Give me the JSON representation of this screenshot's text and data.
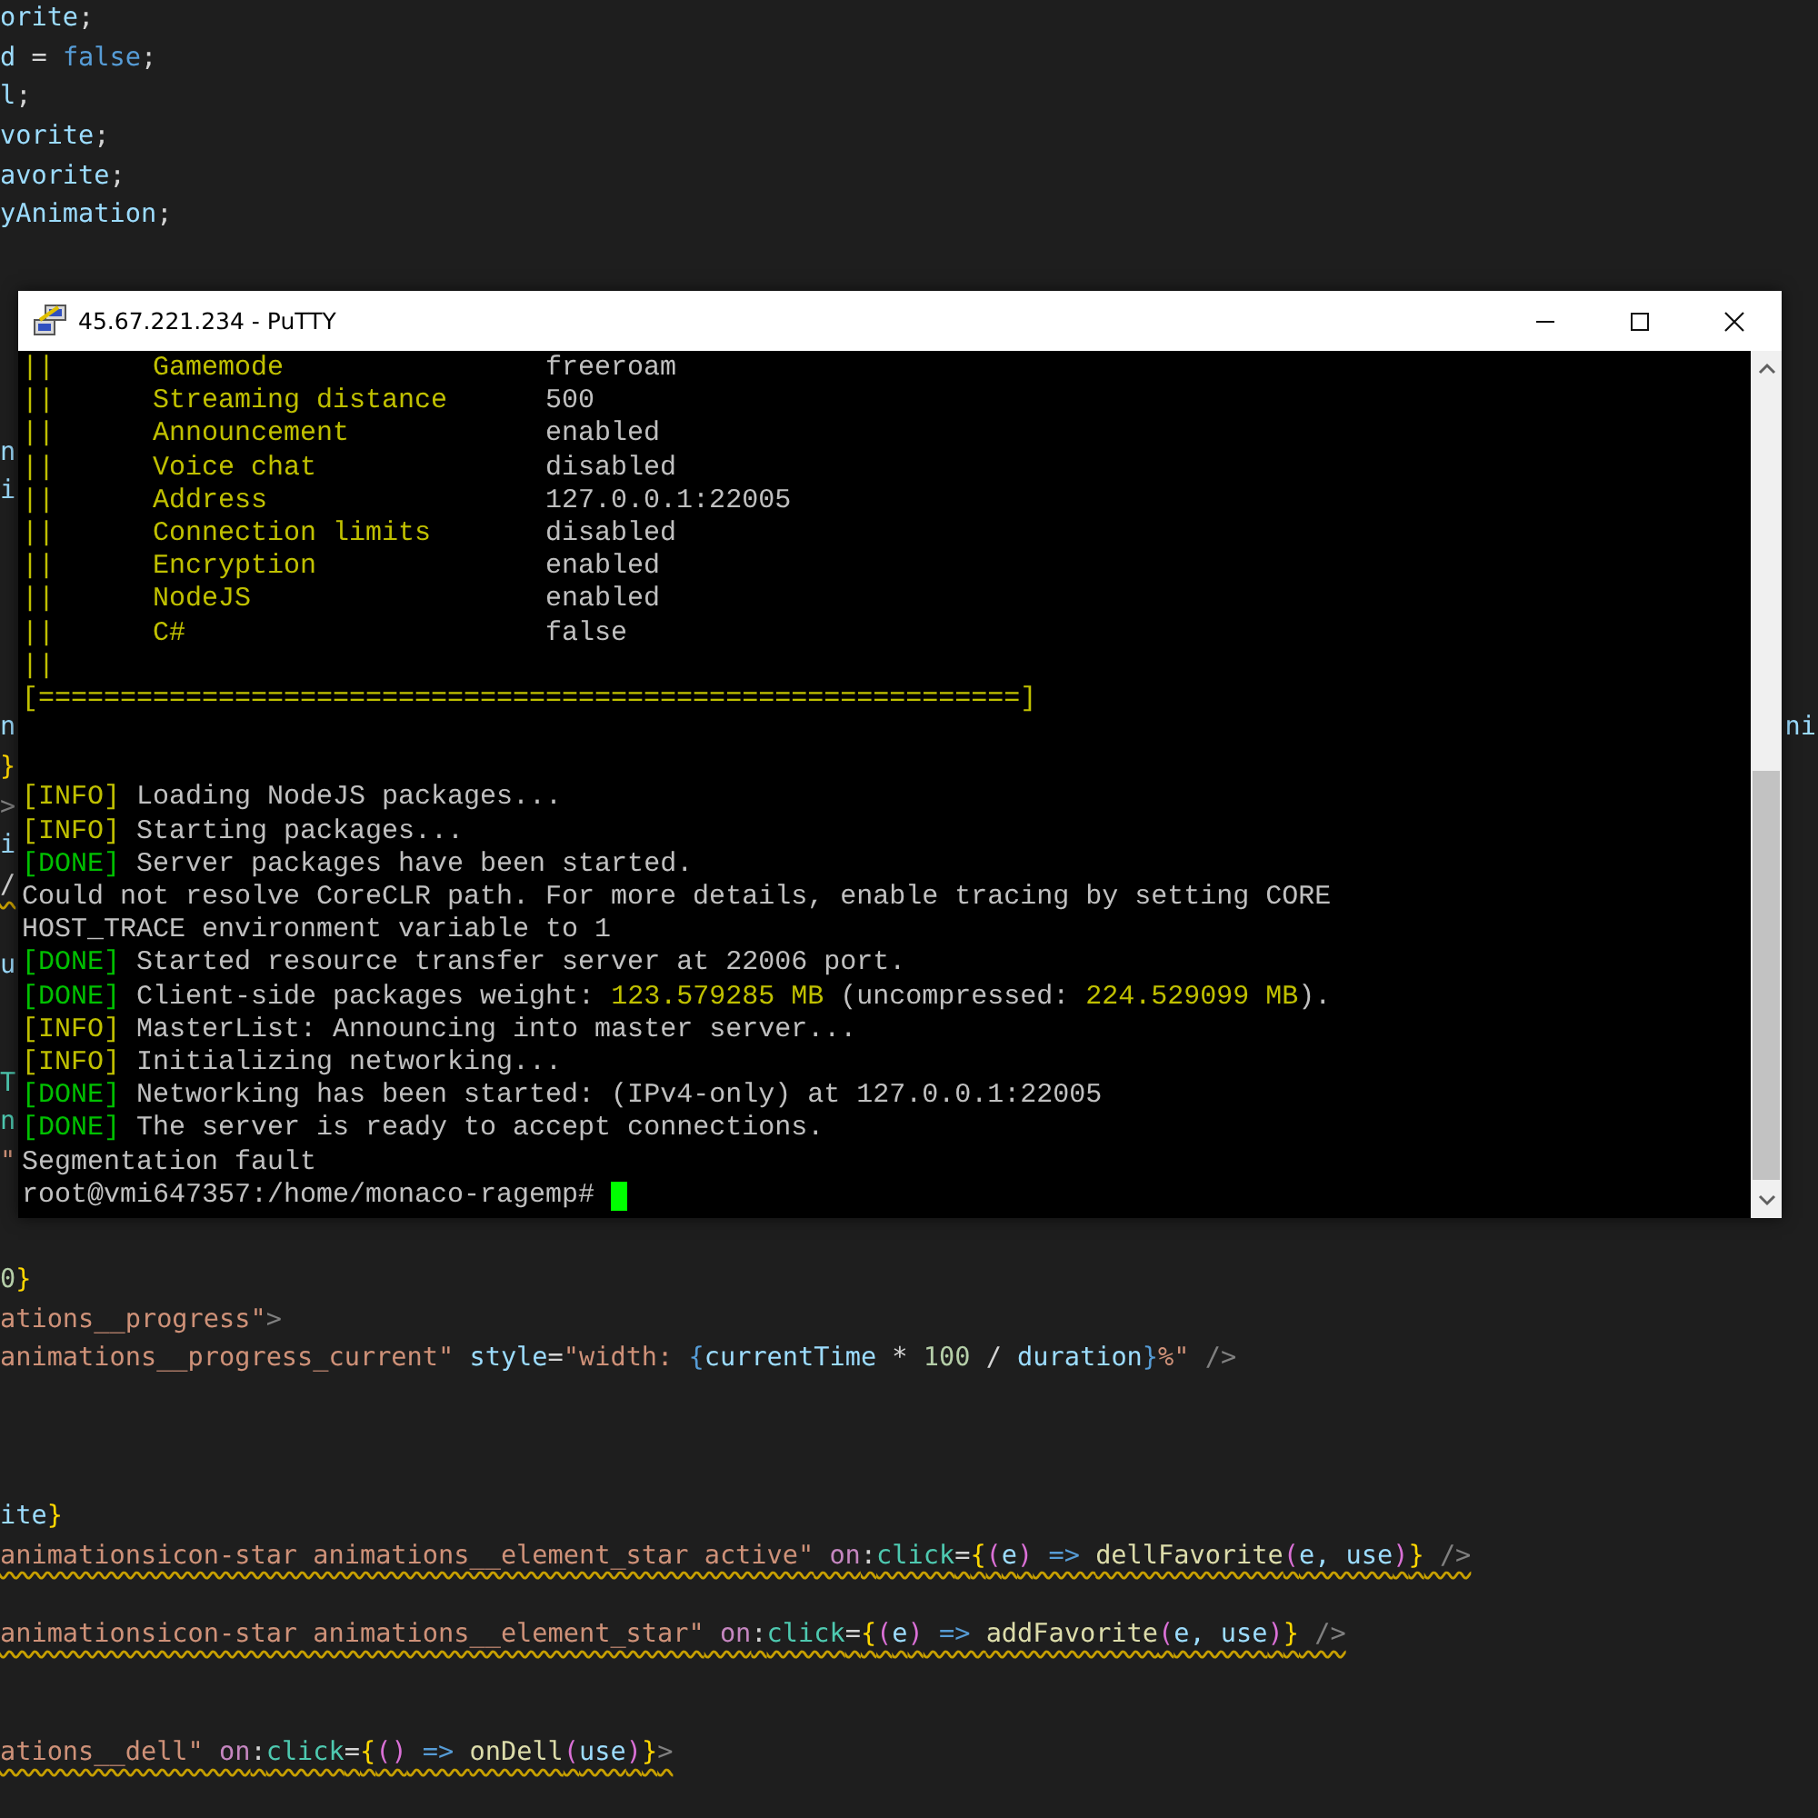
{
  "editor": {
    "lines": [
      {
        "kind": "code",
        "warning": false,
        "tokens": [
          {
            "text": "orite",
            "color": "#9cdcfe"
          },
          {
            "text": ";",
            "color": "#d4d4d4"
          }
        ]
      },
      {
        "kind": "code",
        "warning": false,
        "tokens": [
          {
            "text": "d",
            "color": "#9cdcfe"
          },
          {
            "text": " = ",
            "color": "#d4d4d4"
          },
          {
            "text": "false",
            "color": "#569cd6"
          },
          {
            "text": ";",
            "color": "#d4d4d4"
          }
        ]
      },
      {
        "kind": "code",
        "warning": false,
        "tokens": [
          {
            "text": "l",
            "color": "#9cdcfe"
          },
          {
            "text": ";",
            "color": "#d4d4d4"
          }
        ]
      },
      {
        "kind": "code",
        "warning": false,
        "tokens": [
          {
            "text": "vorite",
            "color": "#9cdcfe"
          },
          {
            "text": ";",
            "color": "#d4d4d4"
          }
        ]
      },
      {
        "kind": "code",
        "warning": false,
        "tokens": [
          {
            "text": "avorite",
            "color": "#9cdcfe"
          },
          {
            "text": ";",
            "color": "#d4d4d4"
          }
        ]
      },
      {
        "kind": "code",
        "warning": false,
        "tokens": [
          {
            "text": "yAnimation",
            "color": "#9cdcfe"
          },
          {
            "text": ";",
            "color": "#d4d4d4"
          }
        ]
      },
      {
        "kind": "blank"
      },
      {
        "kind": "blank"
      },
      {
        "kind": "blank"
      },
      {
        "kind": "blank"
      },
      {
        "kind": "blank"
      },
      {
        "kind": "code",
        "warning": false,
        "tokens": [
          {
            "text": "n",
            "color": "#9cdcfe"
          }
        ]
      },
      {
        "kind": "code",
        "warning": false,
        "tokens": [
          {
            "text": "i",
            "color": "#9cdcfe"
          }
        ]
      },
      {
        "kind": "blank"
      },
      {
        "kind": "blank"
      },
      {
        "kind": "blank"
      },
      {
        "kind": "blank"
      },
      {
        "kind": "blank"
      },
      {
        "kind": "code",
        "warning": false,
        "tokens": [
          {
            "text": "n",
            "color": "#9cdcfe"
          }
        ],
        "right_fragment": "ni"
      },
      {
        "kind": "code",
        "warning": false,
        "tokens": [
          {
            "text": "}",
            "color": "#ffd700"
          }
        ]
      },
      {
        "kind": "code",
        "warning": false,
        "tokens": [
          {
            "text": ">",
            "color": "#808080"
          }
        ]
      },
      {
        "kind": "code",
        "warning": false,
        "tokens": [
          {
            "text": "i",
            "color": "#9cdcfe"
          }
        ]
      },
      {
        "kind": "code",
        "warning": true,
        "tokens": [
          {
            "text": "/",
            "color": "#d4d4d4"
          }
        ]
      },
      {
        "kind": "blank"
      },
      {
        "kind": "code",
        "warning": false,
        "tokens": [
          {
            "text": "u",
            "color": "#9cdcfe"
          }
        ]
      },
      {
        "kind": "blank"
      },
      {
        "kind": "blank"
      },
      {
        "kind": "code",
        "warning": false,
        "tokens": [
          {
            "text": "T",
            "color": "#4ec9b0"
          }
        ]
      },
      {
        "kind": "code",
        "warning": false,
        "tokens": [
          {
            "text": "n",
            "color": "#4ec9b0"
          }
        ]
      },
      {
        "kind": "code",
        "warning": false,
        "tokens": [
          {
            "text": "\"",
            "color": "#ce9178"
          }
        ]
      },
      {
        "kind": "blank"
      },
      {
        "kind": "blank"
      },
      {
        "kind": "code",
        "warning": false,
        "tokens": [
          {
            "text": "0",
            "color": "#b5cea8"
          },
          {
            "text": "}",
            "color": "#ffd700"
          }
        ]
      },
      {
        "kind": "code",
        "warning": false,
        "tokens": [
          {
            "text": "ations__progress\"",
            "color": "#ce9178"
          },
          {
            "text": ">",
            "color": "#808080"
          }
        ]
      },
      {
        "kind": "code",
        "warning": false,
        "tokens": [
          {
            "text": "animations__progress_current\"",
            "color": "#ce9178"
          },
          {
            "text": " style",
            "color": "#9cdcfe"
          },
          {
            "text": "=",
            "color": "#d4d4d4"
          },
          {
            "text": "\"width: ",
            "color": "#ce9178"
          },
          {
            "text": "{",
            "color": "#569cd6"
          },
          {
            "text": "currentTime",
            "color": "#9cdcfe"
          },
          {
            "text": " * ",
            "color": "#d4d4d4"
          },
          {
            "text": "100",
            "color": "#b5cea8"
          },
          {
            "text": " / ",
            "color": "#d4d4d4"
          },
          {
            "text": "duration",
            "color": "#9cdcfe"
          },
          {
            "text": "}",
            "color": "#569cd6"
          },
          {
            "text": "%\"",
            "color": "#ce9178"
          },
          {
            "text": " />",
            "color": "#808080"
          }
        ]
      },
      {
        "kind": "blank"
      },
      {
        "kind": "blank"
      },
      {
        "kind": "blank"
      },
      {
        "kind": "code",
        "warning": false,
        "tokens": [
          {
            "text": "ite",
            "color": "#9cdcfe"
          },
          {
            "text": "}",
            "color": "#ffd700"
          }
        ]
      },
      {
        "kind": "code",
        "warning": true,
        "tokens": [
          {
            "text": "animationsicon-star animations__element_star active\"",
            "color": "#ce9178"
          },
          {
            "text": " on",
            "color": "#c586c0"
          },
          {
            "text": ":",
            "color": "#d4d4d4"
          },
          {
            "text": "click",
            "color": "#4ec9b0"
          },
          {
            "text": "=",
            "color": "#d4d4d4"
          },
          {
            "text": "{",
            "color": "#ffd700"
          },
          {
            "text": "(",
            "color": "#da70d6"
          },
          {
            "text": "e",
            "color": "#9cdcfe"
          },
          {
            "text": ")",
            "color": "#da70d6"
          },
          {
            "text": " => ",
            "color": "#569cd6"
          },
          {
            "text": "dellFavorite",
            "color": "#dcdcaa"
          },
          {
            "text": "(",
            "color": "#da70d6"
          },
          {
            "text": "e, use",
            "color": "#9cdcfe"
          },
          {
            "text": ")",
            "color": "#da70d6"
          },
          {
            "text": "}",
            "color": "#ffd700"
          },
          {
            "text": " />",
            "color": "#808080"
          }
        ]
      },
      {
        "kind": "blank"
      },
      {
        "kind": "code",
        "warning": true,
        "tokens": [
          {
            "text": "animationsicon-star animations__element_star\"",
            "color": "#ce9178"
          },
          {
            "text": " on",
            "color": "#c586c0"
          },
          {
            "text": ":",
            "color": "#d4d4d4"
          },
          {
            "text": "click",
            "color": "#4ec9b0"
          },
          {
            "text": "=",
            "color": "#d4d4d4"
          },
          {
            "text": "{",
            "color": "#ffd700"
          },
          {
            "text": "(",
            "color": "#da70d6"
          },
          {
            "text": "e",
            "color": "#9cdcfe"
          },
          {
            "text": ")",
            "color": "#da70d6"
          },
          {
            "text": " => ",
            "color": "#569cd6"
          },
          {
            "text": "addFavorite",
            "color": "#dcdcaa"
          },
          {
            "text": "(",
            "color": "#da70d6"
          },
          {
            "text": "e, use",
            "color": "#9cdcfe"
          },
          {
            "text": ")",
            "color": "#da70d6"
          },
          {
            "text": "}",
            "color": "#ffd700"
          },
          {
            "text": " />",
            "color": "#808080"
          }
        ]
      },
      {
        "kind": "blank"
      },
      {
        "kind": "blank"
      },
      {
        "kind": "code",
        "warning": true,
        "tokens": [
          {
            "text": "ations__dell\"",
            "color": "#ce9178"
          },
          {
            "text": " on",
            "color": "#c586c0"
          },
          {
            "text": ":",
            "color": "#d4d4d4"
          },
          {
            "text": "click",
            "color": "#4ec9b0"
          },
          {
            "text": "=",
            "color": "#d4d4d4"
          },
          {
            "text": "{",
            "color": "#ffd700"
          },
          {
            "text": "()",
            "color": "#da70d6"
          },
          {
            "text": " => ",
            "color": "#569cd6"
          },
          {
            "text": "onDell",
            "color": "#dcdcaa"
          },
          {
            "text": "(",
            "color": "#da70d6"
          },
          {
            "text": "use",
            "color": "#9cdcfe"
          },
          {
            "text": ")",
            "color": "#da70d6"
          },
          {
            "text": "}",
            "color": "#ffd700"
          },
          {
            "text": ">",
            "color": "#808080"
          }
        ]
      }
    ]
  },
  "terminal": {
    "title": "45.67.221.234 - PuTTY",
    "lines": [
      {
        "kind": "text",
        "segments": [
          {
            "text": "||      Gamemode                ",
            "color": "#c0c000"
          },
          {
            "text": "freeroam",
            "color": "#c0c0c0"
          }
        ]
      },
      {
        "kind": "text",
        "segments": [
          {
            "text": "||      Streaming distance      ",
            "color": "#c0c000"
          },
          {
            "text": "500",
            "color": "#c0c0c0"
          }
        ]
      },
      {
        "kind": "text",
        "segments": [
          {
            "text": "||      Announcement            ",
            "color": "#c0c000"
          },
          {
            "text": "enabled",
            "color": "#c0c0c0"
          }
        ]
      },
      {
        "kind": "text",
        "segments": [
          {
            "text": "||      Voice chat              ",
            "color": "#c0c000"
          },
          {
            "text": "disabled",
            "color": "#c0c0c0"
          }
        ]
      },
      {
        "kind": "text",
        "segments": [
          {
            "text": "||      Address                 ",
            "color": "#c0c000"
          },
          {
            "text": "127.0.0.1:22005",
            "color": "#c0c0c0"
          }
        ]
      },
      {
        "kind": "text",
        "segments": [
          {
            "text": "||      Connection limits       ",
            "color": "#c0c000"
          },
          {
            "text": "disabled",
            "color": "#c0c0c0"
          }
        ]
      },
      {
        "kind": "text",
        "segments": [
          {
            "text": "||      Encryption              ",
            "color": "#c0c000"
          },
          {
            "text": "enabled",
            "color": "#c0c0c0"
          }
        ]
      },
      {
        "kind": "text",
        "segments": [
          {
            "text": "||      NodeJS                  ",
            "color": "#c0c000"
          },
          {
            "text": "enabled",
            "color": "#c0c0c0"
          }
        ]
      },
      {
        "kind": "text",
        "segments": [
          {
            "text": "||      C#                      ",
            "color": "#c0c000"
          },
          {
            "text": "false",
            "color": "#c0c0c0"
          }
        ]
      },
      {
        "kind": "text",
        "segments": [
          {
            "text": "||",
            "color": "#c0c000"
          }
        ]
      },
      {
        "kind": "text",
        "segments": [
          {
            "text": "[============================================================]",
            "color": "#c0c000"
          }
        ]
      },
      {
        "kind": "blank"
      },
      {
        "kind": "blank"
      },
      {
        "kind": "text",
        "segments": [
          {
            "text": "[INFO]",
            "color": "#c0c000"
          },
          {
            "text": " Loading NodeJS packages...",
            "color": "#c0c0c0"
          }
        ]
      },
      {
        "kind": "text",
        "segments": [
          {
            "text": "[INFO]",
            "color": "#c0c000"
          },
          {
            "text": " Starting packages...",
            "color": "#c0c0c0"
          }
        ]
      },
      {
        "kind": "text",
        "segments": [
          {
            "text": "[DONE]",
            "color": "#00c000"
          },
          {
            "text": " Server packages have been started.",
            "color": "#c0c0c0"
          }
        ]
      },
      {
        "kind": "text",
        "segments": [
          {
            "text": "Could not resolve CoreCLR path. For more details, enable tracing by setting CORE",
            "color": "#c0c0c0"
          }
        ]
      },
      {
        "kind": "text",
        "segments": [
          {
            "text": "HOST_TRACE environment variable to 1",
            "color": "#c0c0c0"
          }
        ]
      },
      {
        "kind": "text",
        "segments": [
          {
            "text": "[DONE]",
            "color": "#00c000"
          },
          {
            "text": " Started resource transfer server at 22006 port.",
            "color": "#c0c0c0"
          }
        ]
      },
      {
        "kind": "text",
        "segments": [
          {
            "text": "[DONE]",
            "color": "#00c000"
          },
          {
            "text": " Client-side packages weight: ",
            "color": "#c0c0c0"
          },
          {
            "text": "123.579285 MB",
            "color": "#c0c000"
          },
          {
            "text": " (uncompressed: ",
            "color": "#c0c0c0"
          },
          {
            "text": "224.529099 MB",
            "color": "#c0c000"
          },
          {
            "text": ").",
            "color": "#c0c0c0"
          }
        ]
      },
      {
        "kind": "text",
        "segments": [
          {
            "text": "[INFO]",
            "color": "#c0c000"
          },
          {
            "text": " MasterList: Announcing into master server...",
            "color": "#c0c0c0"
          }
        ]
      },
      {
        "kind": "text",
        "segments": [
          {
            "text": "[INFO]",
            "color": "#c0c000"
          },
          {
            "text": " Initializing networking...",
            "color": "#c0c0c0"
          }
        ]
      },
      {
        "kind": "text",
        "segments": [
          {
            "text": "[DONE]",
            "color": "#00c000"
          },
          {
            "text": " Networking has been started: (IPv4-only) at 127.0.0.1:22005",
            "color": "#c0c0c0"
          }
        ]
      },
      {
        "kind": "text",
        "segments": [
          {
            "text": "[DONE]",
            "color": "#00c000"
          },
          {
            "text": " The server is ready to accept connections.",
            "color": "#c0c0c0"
          }
        ]
      },
      {
        "kind": "text",
        "segments": [
          {
            "text": "Segmentation fault",
            "color": "#c0c0c0"
          }
        ]
      },
      {
        "kind": "prompt",
        "segments": [
          {
            "text": "root@vmi647357:/home/monaco-ragemp# ",
            "color": "#c0c0c0"
          }
        ]
      }
    ]
  }
}
